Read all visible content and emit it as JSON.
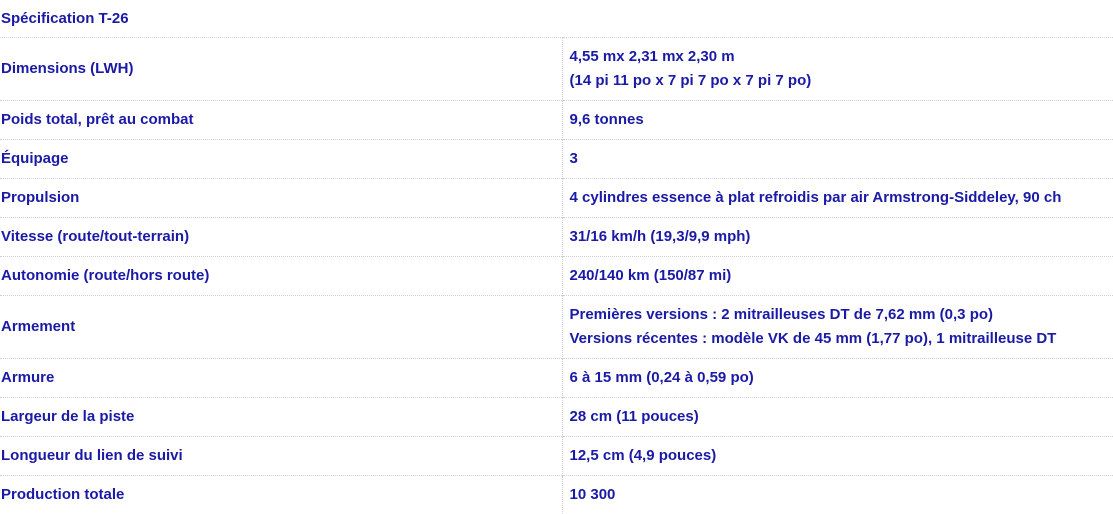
{
  "table": {
    "title": "Spécification T-26",
    "rows": [
      {
        "label": "Dimensions (LWH)",
        "value": [
          "4,55 mx 2,31 mx 2,30 m",
          "(14 pi 11 po x 7 pi 7 po x 7 pi 7 po)"
        ]
      },
      {
        "label": "Poids total, prêt au combat",
        "value": [
          "9,6 tonnes"
        ]
      },
      {
        "label": "Équipage",
        "value": [
          "3"
        ]
      },
      {
        "label": "Propulsion",
        "value": [
          "4 cylindres essence à plat refroidis par air Armstrong-Siddeley, 90 ch"
        ]
      },
      {
        "label": "Vitesse (route/tout-terrain)",
        "value": [
          "31/16 km/h (19,3/9,9 mph)"
        ]
      },
      {
        "label": "Autonomie (route/hors route)",
        "value": [
          "240/140 km (150/87 mi)"
        ]
      },
      {
        "label": "Armement",
        "value": [
          "Premières versions : 2 mitrailleuses DT de 7,62 mm (0,3 po)",
          "Versions récentes : modèle VK de 45 mm (1,77 po), 1 mitrailleuse DT"
        ]
      },
      {
        "label": "Armure",
        "value": [
          "6 à 15 mm (0,24 à 0,59 po)"
        ]
      },
      {
        "label": "Largeur de la piste",
        "value": [
          "28 cm (11 pouces)"
        ]
      },
      {
        "label": "Longueur du lien de suivi",
        "value": [
          "12,5 cm (4,9 pouces)"
        ]
      },
      {
        "label": "Production totale",
        "value": [
          "10 300"
        ]
      }
    ]
  }
}
